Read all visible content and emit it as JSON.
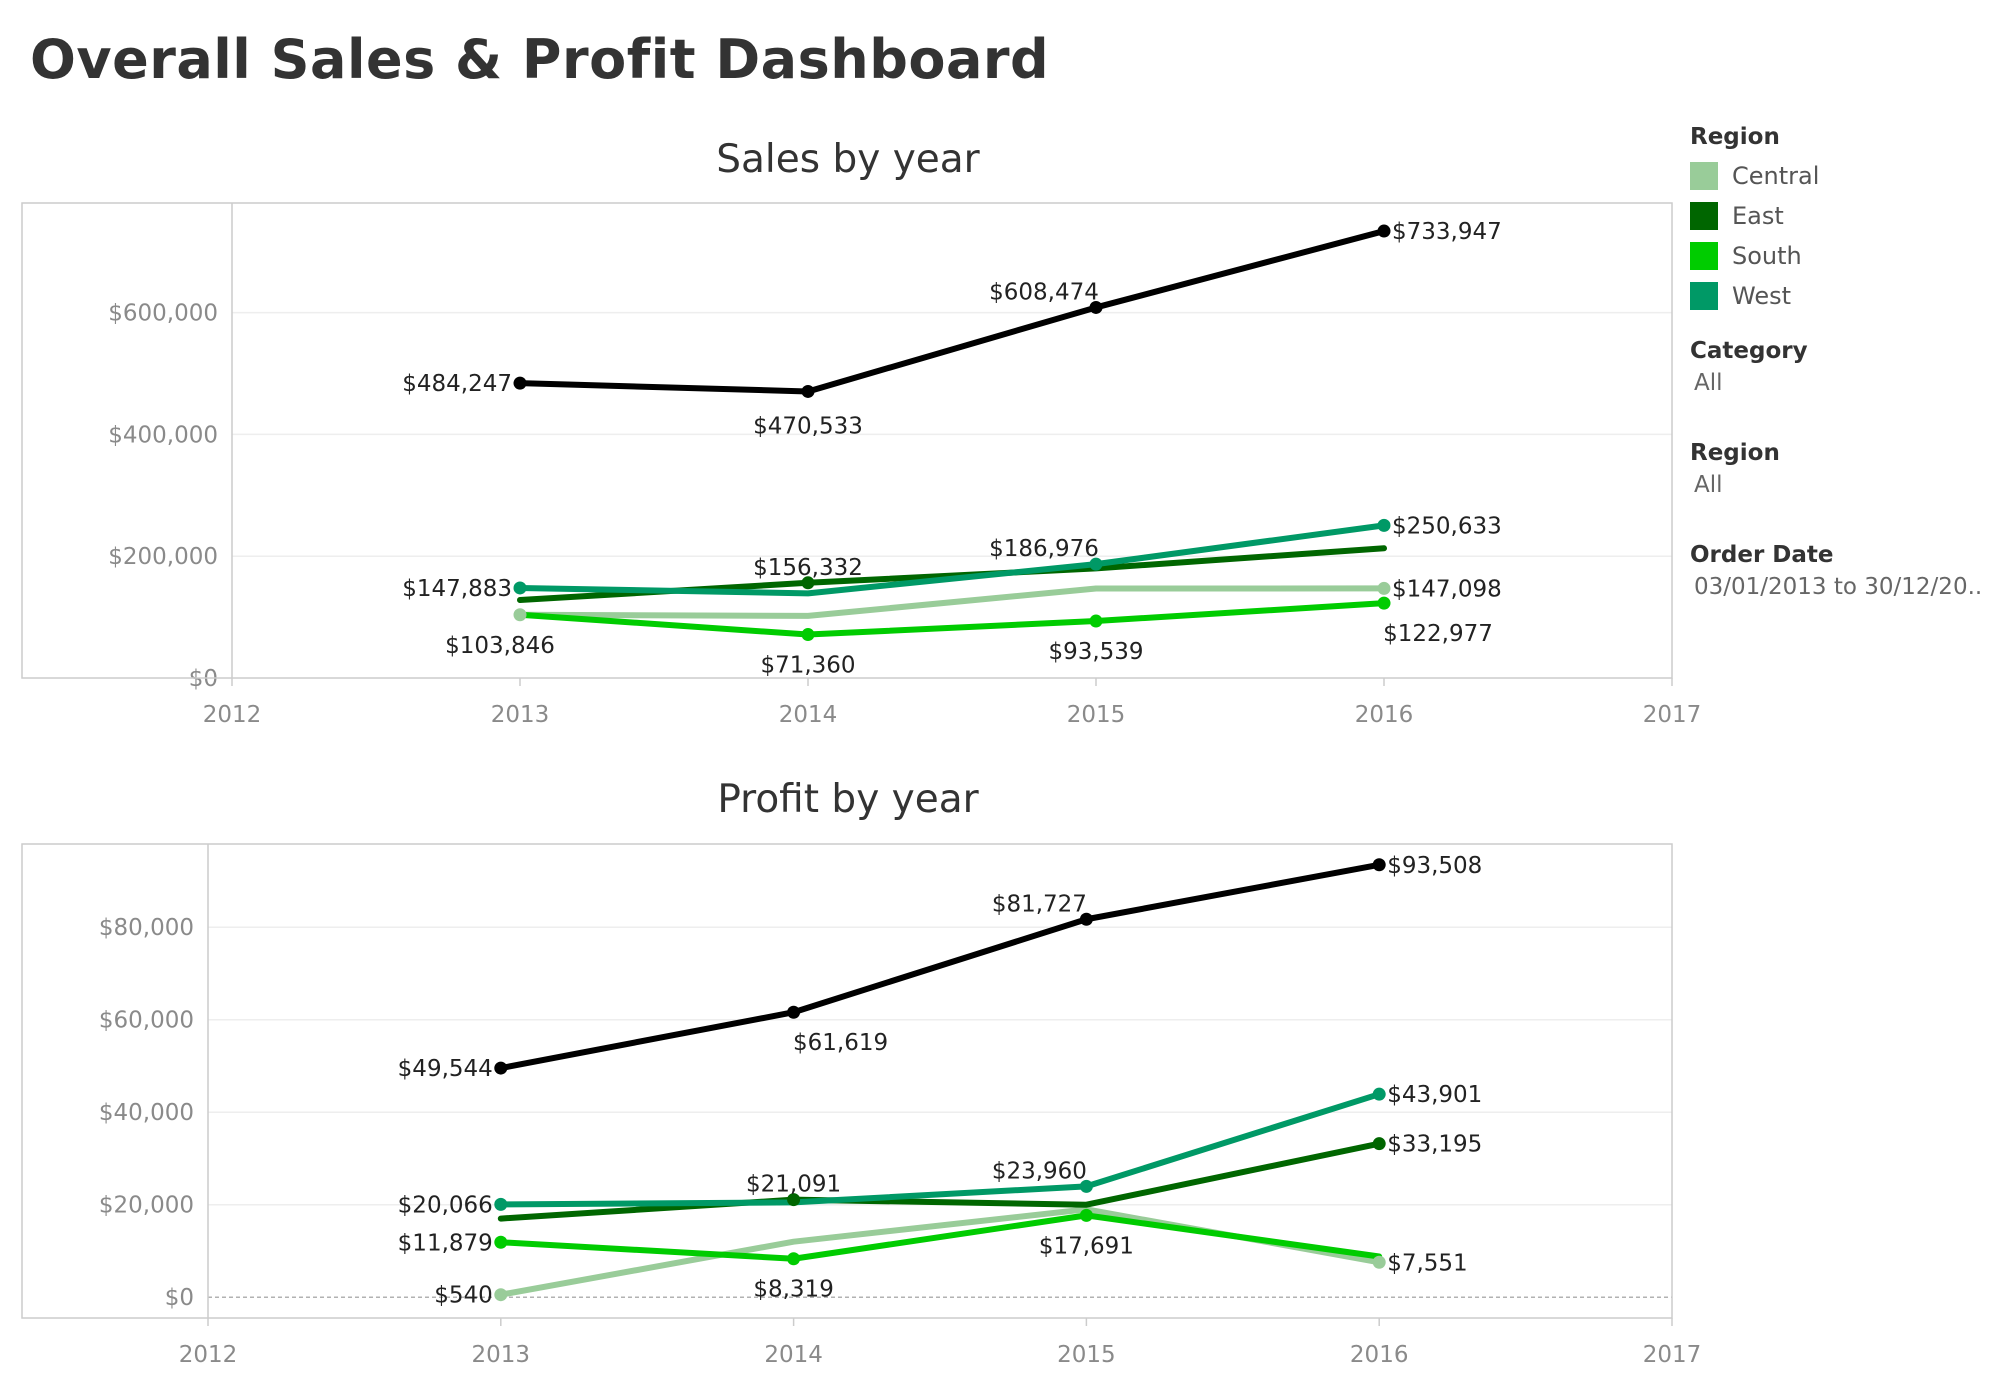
{
  "dashboard_title": "Overall Sales & Profit Dashboard",
  "legend": {
    "title": "Region",
    "items": [
      {
        "label": "Central",
        "color": "#99cc99"
      },
      {
        "label": "East",
        "color": "#006600"
      },
      {
        "label": "South",
        "color": "#00cc00"
      },
      {
        "label": "West",
        "color": "#009966"
      }
    ]
  },
  "filters": [
    {
      "title": "Category",
      "value": "All"
    },
    {
      "title": "Region",
      "value": "All"
    },
    {
      "title": "Order Date",
      "value": "03/01/2013 to 30/12/20.."
    }
  ],
  "colors": {
    "total": "#000000",
    "gridline": "#eeeeee",
    "axis": "#cccccc"
  },
  "chart_data": [
    {
      "type": "line",
      "title": "Sales by year",
      "xlabel": "",
      "ylabel": "",
      "x_ticks": [
        "2012",
        "2013",
        "2014",
        "2015",
        "2016",
        "2017"
      ],
      "x": [
        2013,
        2014,
        2015,
        2016
      ],
      "xlim": [
        2012,
        2017
      ],
      "ylim": [
        0,
        780000
      ],
      "y_ticks": [
        0,
        200000,
        400000,
        600000
      ],
      "y_tick_labels": [
        "$0",
        "$200,000",
        "$400,000",
        "$600,000"
      ],
      "grid": true,
      "series": [
        {
          "key": "total",
          "values": [
            484247,
            470533,
            608474,
            733947
          ],
          "color": "#000000",
          "labels": [
            "$484,247",
            "$470,533",
            "$608,474",
            "$733,947"
          ]
        },
        {
          "key": "west",
          "name": "West",
          "values": [
            147883,
            139000,
            186976,
            250633
          ],
          "color": "#009966",
          "labels": [
            "$147,883",
            "",
            "$186,976",
            "$250,633"
          ]
        },
        {
          "key": "east",
          "name": "East",
          "values": [
            128000,
            156332,
            180000,
            213000
          ],
          "color": "#006600",
          "labels": [
            "",
            "$156,332",
            "",
            ""
          ]
        },
        {
          "key": "central",
          "name": "Central",
          "values": [
            103846,
            102000,
            147000,
            147098
          ],
          "color": "#99cc99",
          "labels": [
            "$103,846",
            "",
            "",
            "$147,098"
          ]
        },
        {
          "key": "south",
          "name": "South",
          "values": [
            103846,
            71360,
            93539,
            122977
          ],
          "color": "#00cc00",
          "labels": [
            "",
            "$71,360",
            "$93,539",
            "$122,977"
          ]
        }
      ]
    },
    {
      "type": "line",
      "title": "Profit by year",
      "xlabel": "",
      "ylabel": "",
      "x_ticks": [
        "2012",
        "2013",
        "2014",
        "2015",
        "2016",
        "2017"
      ],
      "x": [
        2013,
        2014,
        2015,
        2016
      ],
      "xlim": [
        2012,
        2017
      ],
      "ylim": [
        -4500,
        98000
      ],
      "y_ticks": [
        0,
        20000,
        40000,
        60000,
        80000
      ],
      "y_tick_labels": [
        "$0",
        "$20,000",
        "$40,000",
        "$60,000",
        "$80,000"
      ],
      "grid": true,
      "series": [
        {
          "key": "total",
          "values": [
            49544,
            61619,
            81727,
            93508
          ],
          "color": "#000000",
          "labels": [
            "$49,544",
            "$61,619",
            "$81,727",
            "$93,508"
          ]
        },
        {
          "key": "west",
          "name": "West",
          "values": [
            20066,
            20500,
            23960,
            43901
          ],
          "color": "#009966",
          "labels": [
            "$20,066",
            "",
            "$23,960",
            "$43,901"
          ]
        },
        {
          "key": "east",
          "name": "East",
          "values": [
            17000,
            21091,
            20000,
            33195
          ],
          "color": "#006600",
          "labels": [
            "",
            "$21,091",
            "",
            "$33,195"
          ]
        },
        {
          "key": "central",
          "name": "Central",
          "values": [
            540,
            12000,
            19000,
            7551
          ],
          "color": "#99cc99",
          "labels": [
            "$540",
            "",
            "",
            "$7,551"
          ]
        },
        {
          "key": "south",
          "name": "South",
          "values": [
            11879,
            8319,
            17691,
            8800
          ],
          "color": "#00cc00",
          "labels": [
            "$11,879",
            "$8,319",
            "$17,691",
            ""
          ]
        }
      ]
    }
  ]
}
